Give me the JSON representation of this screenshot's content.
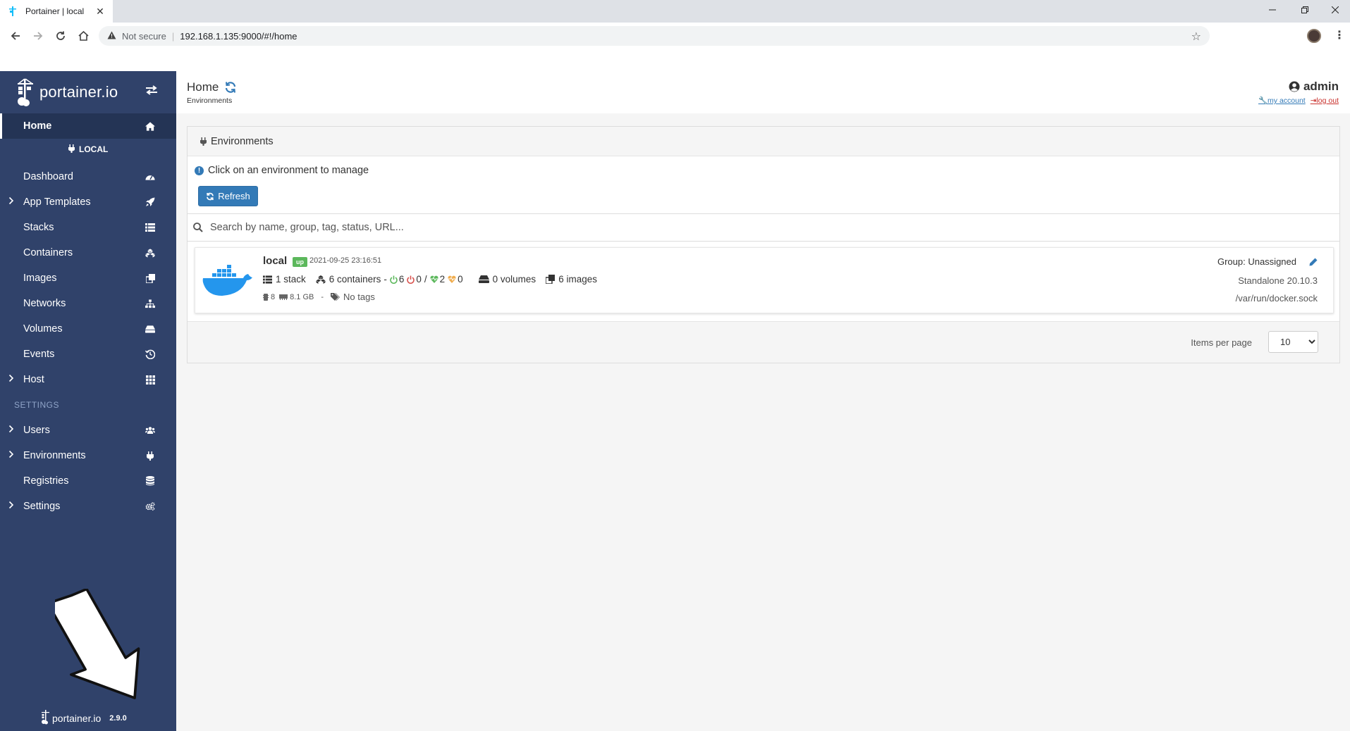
{
  "browser": {
    "tab_title": "Portainer | local",
    "tab_close": "✕",
    "security_label": "Not secure",
    "url": "192.168.1.135:9000/#!/home"
  },
  "sidebar": {
    "brand": "portainer.io",
    "endpoint_label": "LOCAL",
    "items": [
      {
        "label": "Home",
        "icon": "home-icon"
      },
      {
        "label": "Dashboard",
        "icon": "tachometer-icon"
      },
      {
        "label": "App Templates",
        "icon": "rocket-icon"
      },
      {
        "label": "Stacks",
        "icon": "th-list-icon"
      },
      {
        "label": "Containers",
        "icon": "cubes-icon"
      },
      {
        "label": "Images",
        "icon": "clone-icon"
      },
      {
        "label": "Networks",
        "icon": "sitemap-icon"
      },
      {
        "label": "Volumes",
        "icon": "hdd-icon"
      },
      {
        "label": "Events",
        "icon": "history-icon"
      },
      {
        "label": "Host",
        "icon": "th-icon"
      }
    ],
    "settings_title": "SETTINGS",
    "settings_items": [
      {
        "label": "Users",
        "icon": "users-icon"
      },
      {
        "label": "Environments",
        "icon": "plug-icon"
      },
      {
        "label": "Registries",
        "icon": "database-icon"
      },
      {
        "label": "Settings",
        "icon": "cogs-icon"
      }
    ],
    "footer_brand": "portainer.io",
    "version": "2.9.0"
  },
  "header": {
    "title": "Home",
    "breadcrumb": "Environments",
    "username": "admin",
    "my_account": "my account",
    "log_out": "log out"
  },
  "environments_widget": {
    "title": "Environments",
    "hint": "Click on an environment to manage",
    "refresh_label": "Refresh",
    "search_placeholder": "Search by name, group, tag, status, URL...",
    "items_per_page_label": "Items per page",
    "items_per_page": "10",
    "environments": [
      {
        "name": "local",
        "status": "up",
        "timestamp": "2021-09-25 23:16:51",
        "stacks": "1 stack",
        "containers": "6 containers",
        "running": "6",
        "stopped": "0",
        "separator": "/",
        "healthy": "2",
        "unhealthy": "0",
        "volumes": "0 volumes",
        "images": "6 images",
        "cpu": "8",
        "memory": "8.1 GB",
        "tags": "No tags",
        "group": "Group: Unassigned",
        "version": "Standalone 20.10.3",
        "url": "/var/run/docker.sock"
      }
    ]
  },
  "colors": {
    "sidebar_bg": "#30426a",
    "sidebar_active": "#243455",
    "primary": "#337ab7",
    "status_up": "#5cb85c",
    "running": "#5cb85c",
    "stopped": "#d9534f",
    "healthy": "#5cb85c",
    "unhealthy": "#f0ad4e"
  }
}
